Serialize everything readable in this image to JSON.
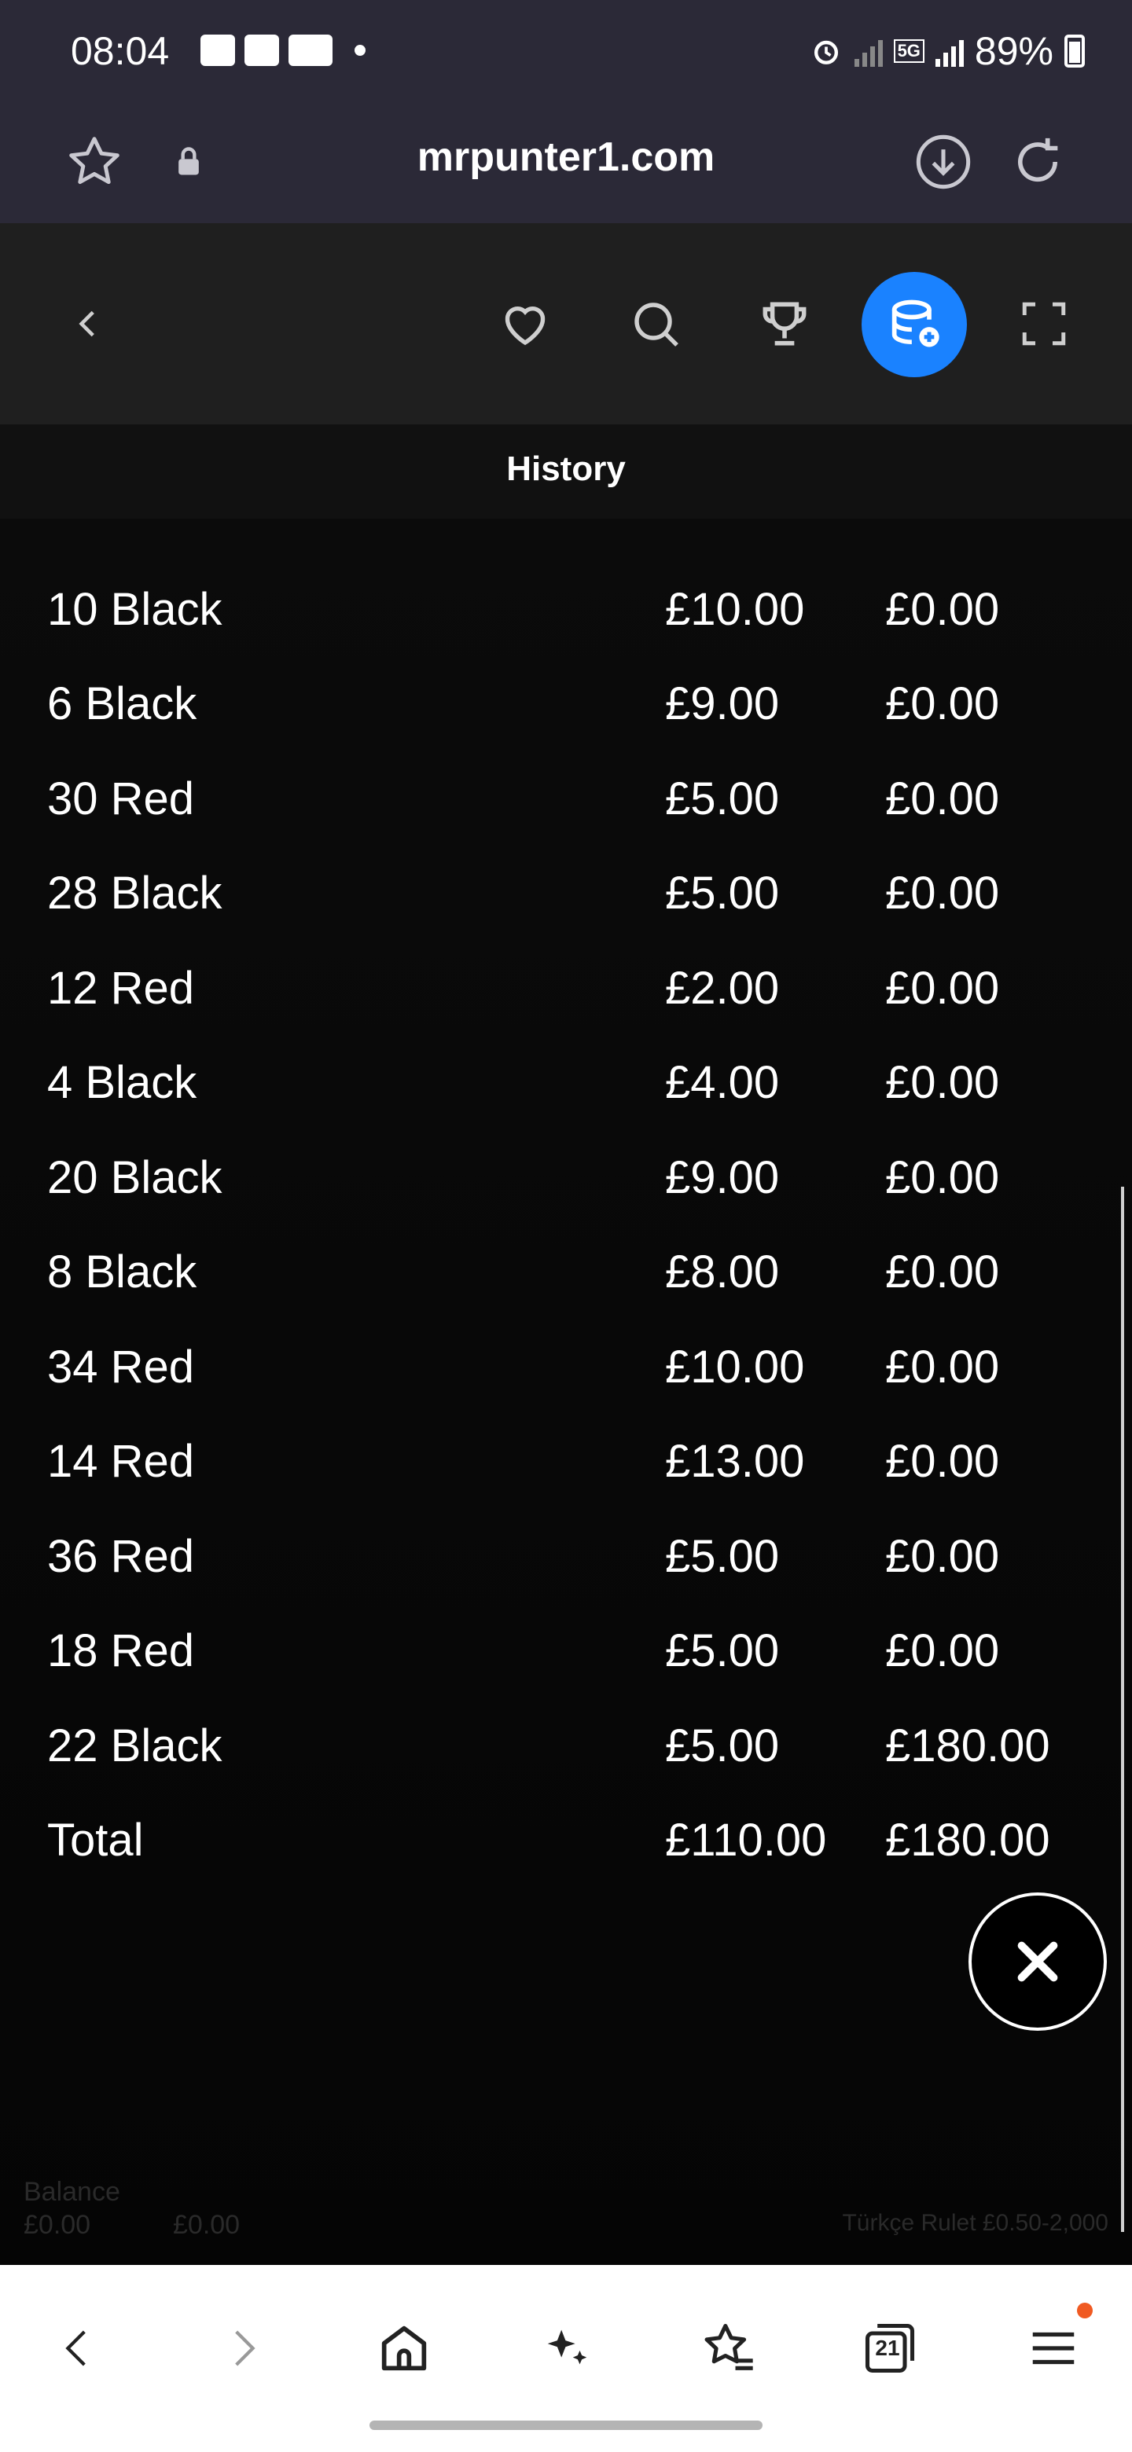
{
  "status_bar": {
    "time": "08:04",
    "battery": "89%",
    "network_label": "5G",
    "icons": [
      "gallery-icon",
      "mail-icon",
      "youtube-icon",
      "alarm-icon",
      "signal-icon",
      "battery-icon"
    ]
  },
  "browser": {
    "url": "mrpunter1.com"
  },
  "game_header": {
    "icons": [
      "back-chevron-icon",
      "heart-icon",
      "search-icon",
      "trophy-icon",
      "database-plus-icon",
      "fullscreen-icon"
    ],
    "active_color": "#1a82ff"
  },
  "history": {
    "title": "History",
    "rows": [
      {
        "result": "10 Black",
        "bet": "£10.00",
        "win": "£0.00"
      },
      {
        "result": "6 Black",
        "bet": "£9.00",
        "win": "£0.00"
      },
      {
        "result": "30 Red",
        "bet": "£5.00",
        "win": "£0.00"
      },
      {
        "result": "28 Black",
        "bet": "£5.00",
        "win": "£0.00"
      },
      {
        "result": "12 Red",
        "bet": "£2.00",
        "win": "£0.00"
      },
      {
        "result": "4 Black",
        "bet": "£4.00",
        "win": "£0.00"
      },
      {
        "result": "20 Black",
        "bet": "£9.00",
        "win": "£0.00"
      },
      {
        "result": "8 Black",
        "bet": "£8.00",
        "win": "£0.00"
      },
      {
        "result": "34 Red",
        "bet": "£10.00",
        "win": "£0.00"
      },
      {
        "result": "14 Red",
        "bet": "£13.00",
        "win": "£0.00"
      },
      {
        "result": "36 Red",
        "bet": "£5.00",
        "win": "£0.00"
      },
      {
        "result": "18 Red",
        "bet": "£5.00",
        "win": "£0.00"
      },
      {
        "result": "22 Black",
        "bet": "£5.00",
        "win": "£180.00"
      }
    ],
    "total": {
      "label": "Total",
      "bet": "£110.00",
      "win": "£180.00"
    }
  },
  "background": {
    "balance_label": "Balance",
    "balance_value": "£0.00",
    "bet_value": "£0.00",
    "table_name": "Türkçe Rulet £0.50-2,000"
  },
  "bottom_nav": {
    "tabs_count": "21"
  }
}
